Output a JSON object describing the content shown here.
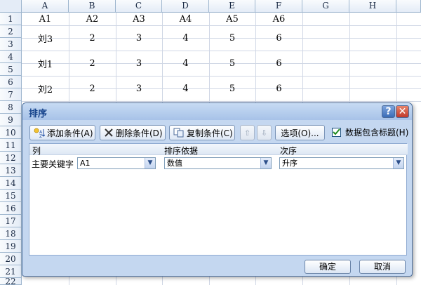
{
  "sheet": {
    "columns": [
      "A",
      "B",
      "C",
      "D",
      "E",
      "F",
      "G",
      "H"
    ],
    "rows": [
      "1",
      "2",
      "3",
      "4",
      "5",
      "6",
      "7",
      "8",
      "9",
      "10",
      "11",
      "12",
      "13",
      "14",
      "15",
      "16",
      "17",
      "18",
      "19",
      "20",
      "21",
      "22"
    ],
    "header_row": [
      "A1",
      "A2",
      "A3",
      "A4",
      "A5",
      "A6"
    ],
    "data_rows": [
      [
        "刘3",
        "2",
        "3",
        "4",
        "5",
        "6"
      ],
      [
        "刘1",
        "2",
        "3",
        "4",
        "5",
        "6"
      ],
      [
        "刘2",
        "2",
        "3",
        "4",
        "5",
        "6"
      ]
    ]
  },
  "dialog": {
    "title": "排序",
    "help_label": "?",
    "close_label": "✕",
    "toolbar": {
      "add_label": "添加条件(A)",
      "delete_label": "删除条件(D)",
      "copy_label": "复制条件(C)",
      "up_label": "⇧",
      "down_label": "⇩",
      "options_label": "选项(O)...",
      "header_checkbox_label": "数据包含标题(H)",
      "header_checkbox_checked": true
    },
    "list": {
      "col_header": "列",
      "basis_header": "排序依据",
      "order_header": "次序",
      "row_label": "主要关键字",
      "column_value": "A1",
      "basis_value": "数值",
      "order_value": "升序"
    },
    "ok_label": "确定",
    "cancel_label": "取消"
  }
}
